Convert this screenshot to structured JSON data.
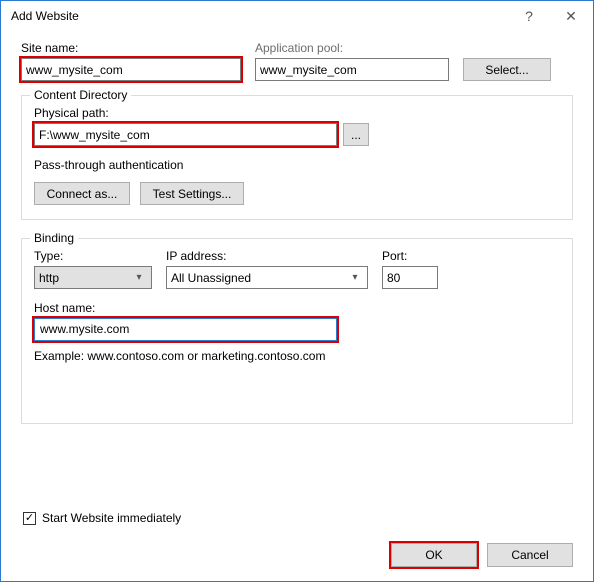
{
  "titlebar": {
    "title": "Add Website",
    "help": "?",
    "close": "✕"
  },
  "siteName": {
    "label": "Site name:",
    "value": "www_mysite_com"
  },
  "appPool": {
    "label": "Application pool:",
    "value": "www_mysite_com",
    "selectBtn": "Select..."
  },
  "contentDir": {
    "legend": "Content Directory",
    "physicalPathLabel": "Physical path:",
    "physicalPathValue": "F:\\www_mysite_com",
    "browse": "...",
    "passThrough": "Pass-through authentication",
    "connectAs": "Connect as...",
    "testSettings": "Test Settings..."
  },
  "binding": {
    "legend": "Binding",
    "typeLabel": "Type:",
    "typeValue": "http",
    "ipLabel": "IP address:",
    "ipValue": "All Unassigned",
    "portLabel": "Port:",
    "portValue": "80",
    "hostLabel": "Host name:",
    "hostValue": "www.mysite.com",
    "example": "Example: www.contoso.com or marketing.contoso.com"
  },
  "startImmediately": {
    "label": "Start Website immediately",
    "checked": "✓"
  },
  "footer": {
    "ok": "OK",
    "cancel": "Cancel"
  }
}
